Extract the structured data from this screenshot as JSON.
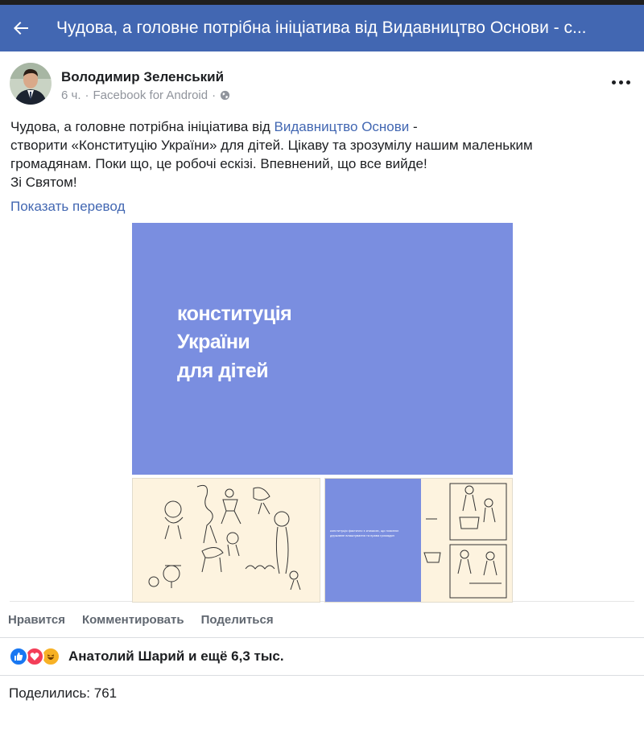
{
  "header": {
    "title": "Чудова, а головне потрібна ініціатива від Видавництво Основи - с...",
    "back_icon": "arrow-left-icon",
    "background": "#4267b2"
  },
  "post": {
    "author": "Володимир Зеленський",
    "time": "6 ч.",
    "separator": "·",
    "source": "Facebook for Android",
    "privacy_icon": "globe-icon",
    "text_before_link": "Чудова, а головне потрібна ініціатива від ",
    "link": "Видавництво Основи",
    "text_after_link": " -",
    "lines": [
      "створити «Конституцію України» для дітей. Цікаву та зрозумілу нашим маленьким",
      "громадянам. Поки що, це робочі ескізі. Впевнений, що все вийде!",
      "Зі Святом!"
    ],
    "translate": "Показать перевод"
  },
  "gallery": {
    "main_title_lines": [
      "конституція",
      "України",
      "для дітей"
    ],
    "thumb_text": "конституція фактично є книжкою, що пояснює державне влаштування та права громадян",
    "main_color": "#7a8ee0"
  },
  "actions": {
    "like": "Нравится",
    "comment": "Комментировать",
    "share": "Поделиться"
  },
  "reactions": {
    "icons": [
      "like-icon",
      "love-icon",
      "haha-icon"
    ],
    "text": "Анатолий Шарий и ещё 6,3 тыс."
  },
  "shares": {
    "text": "Поделились: 761"
  }
}
